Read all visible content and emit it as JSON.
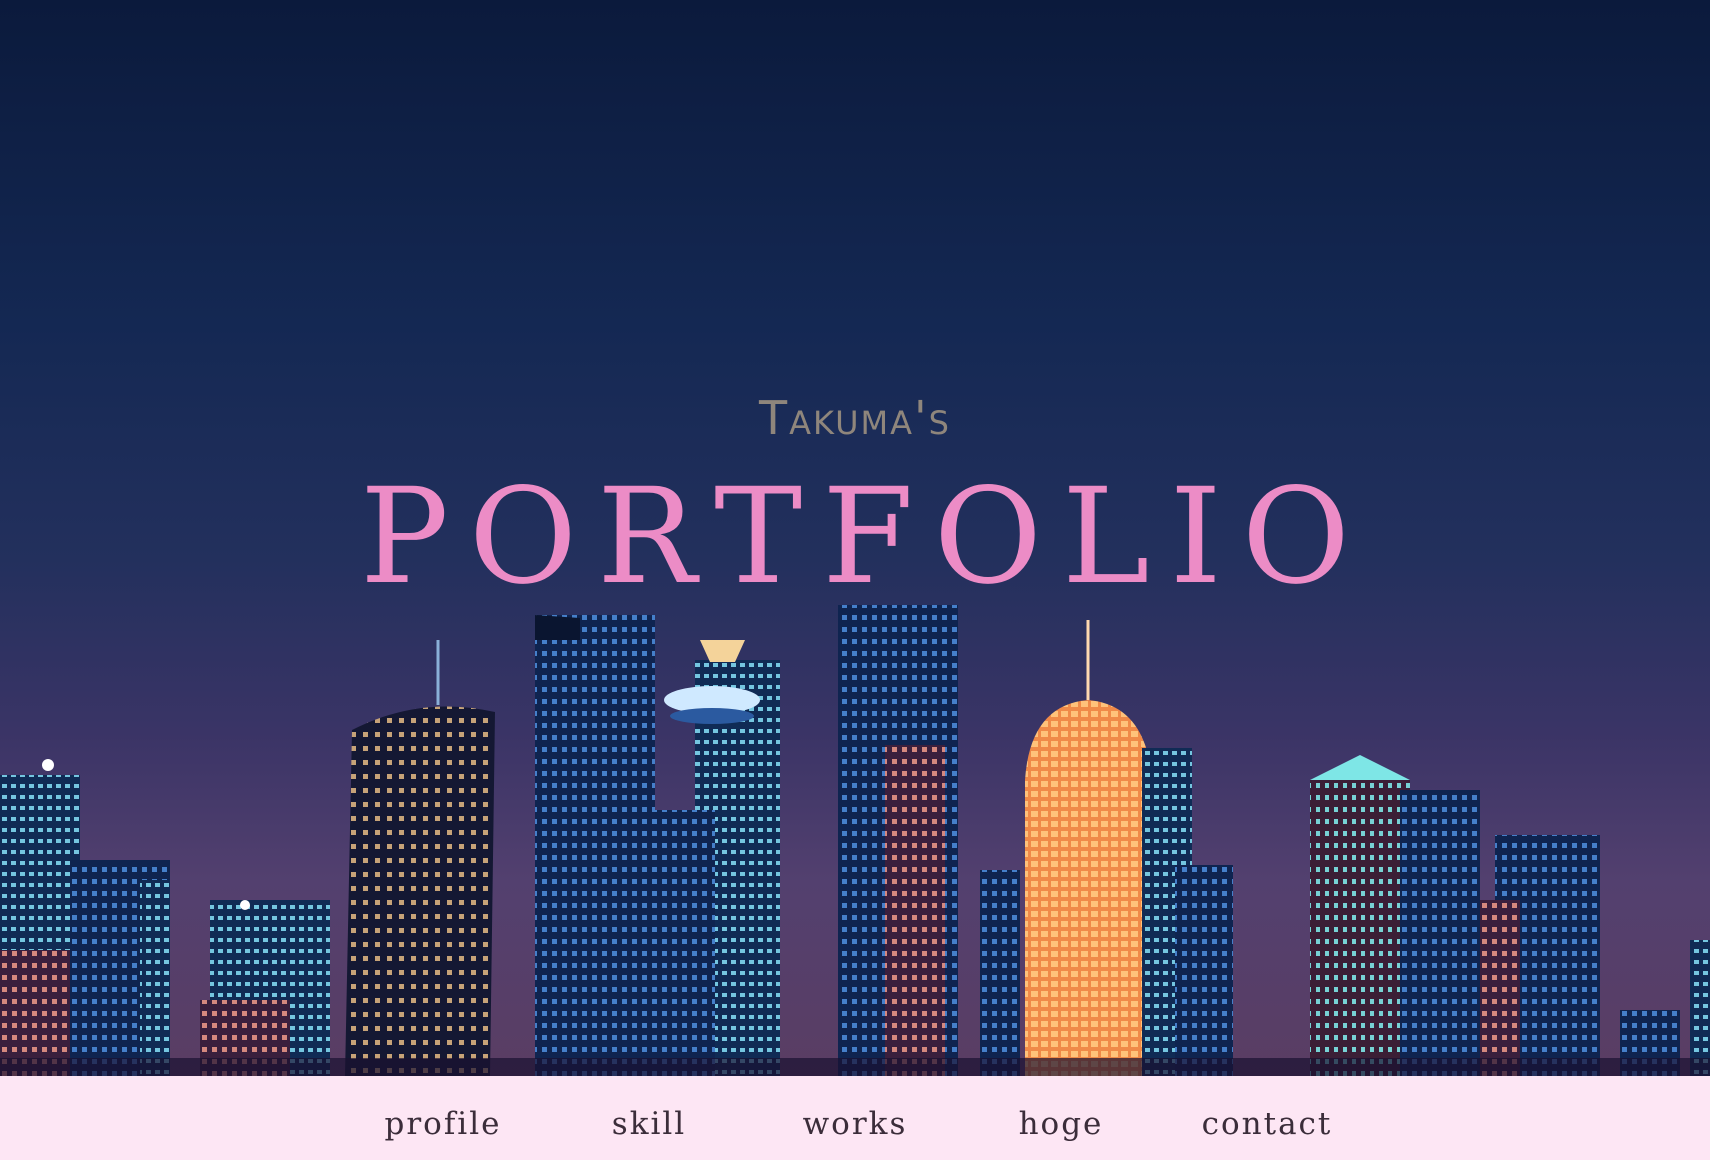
{
  "hero": {
    "subtitle": "Takuma's",
    "title": "PORTFOLIO"
  },
  "nav": {
    "items": [
      {
        "label": "profile"
      },
      {
        "label": "skill"
      },
      {
        "label": "works"
      },
      {
        "label": "hoge"
      },
      {
        "label": "contact"
      }
    ]
  },
  "colors": {
    "title": "#ec8cc6",
    "subtitle": "#8f867c",
    "nav_background": "#fde6f4",
    "nav_text": "#3b2d3a",
    "sky_top": "#0b1a3c",
    "sky_bottom": "#5a3d63"
  }
}
